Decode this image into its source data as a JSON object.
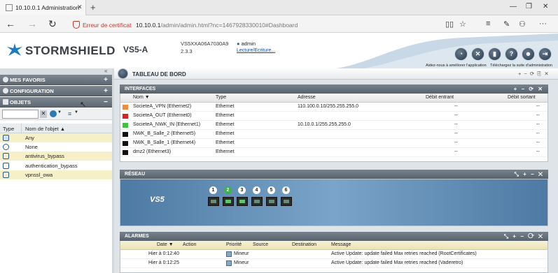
{
  "browser": {
    "tab_title": "10.10.0.1 Administration",
    "tab_close": "✕",
    "new_tab": "+",
    "cert_warning": "Erreur de certificat",
    "url_host": "10.10.0.1",
    "url_path": "/admin/admin.html?nc=1467928330010#Dashboard"
  },
  "header": {
    "brand": "STORMSHIELD",
    "model": "VS5-A",
    "serial": "VS5XXA06A7030A9",
    "version": "2.3.3",
    "user": "admin",
    "access_link": "Lecture/Ecriture...",
    "help_left": "Aidez-nous à améliorer l'application",
    "help_right": "Téléchargez la suite d'administration"
  },
  "sidebar": {
    "sections": [
      {
        "label": "MES FAVORIS",
        "toggle": "+"
      },
      {
        "label": "CONFIGURATION",
        "toggle": "+"
      },
      {
        "label": "OBJETS",
        "toggle": "−"
      }
    ],
    "col_type": "Type",
    "col_name": "Nom de l'objet ▲",
    "objects": [
      "Any",
      "None",
      "antivirus_bypass",
      "authentication_bypass",
      "vpnssl_owa"
    ]
  },
  "dashboard": {
    "title": "TABLEAU DE BORD",
    "controls": "+ − ⟳ ⎘ ✕"
  },
  "interfaces": {
    "title": "INTERFACES",
    "controls": "+ − ⟳ ✕",
    "columns": [
      "Nom ▼",
      "Type",
      "Adresse",
      "Débit entrant",
      "Débit sortant"
    ],
    "rows": [
      {
        "name": "SocieteA_VPN (Ethernet2)",
        "type": "Ethernet",
        "address": "110.100.0.10/255.255.255.0",
        "in": "--",
        "out": "--",
        "color": "#f08a3c"
      },
      {
        "name": "SocieteA_OUT (Ethernet0)",
        "type": "Ethernet",
        "address": "",
        "in": "--",
        "out": "--",
        "color": "#e02020"
      },
      {
        "name": "SocieteA_NWK_IN (Ethernet1)",
        "type": "Ethernet",
        "address": "10.10.0.1/255.255.255.0",
        "in": "--",
        "out": "--",
        "color": "#3cc23c"
      },
      {
        "name": "NWK_B_Salle_2 (Ethernet5)",
        "type": "Ethernet",
        "address": "",
        "in": "--",
        "out": "--",
        "color": "#111111"
      },
      {
        "name": "NWK_B_Salle_1 (Ethernet4)",
        "type": "Ethernet",
        "address": "",
        "in": "--",
        "out": "--",
        "color": "#111111"
      },
      {
        "name": "dmz2 (Ethernet3)",
        "type": "Ethernet",
        "address": "",
        "in": "--",
        "out": "--",
        "color": "#111111"
      }
    ]
  },
  "network": {
    "title": "RÉSEAU",
    "controls": "⤡ + − ✕",
    "model_label": "VS5",
    "ports": [
      "1",
      "2",
      "3",
      "4",
      "5",
      "6"
    ],
    "active_port": "2"
  },
  "alarms": {
    "title": "ALARMES",
    "controls": "⤡ + − ⟳ ✕",
    "columns": [
      "Date ▼",
      "Action",
      "Priorité",
      "Source",
      "Destination",
      "Message"
    ],
    "rows": [
      {
        "date": "Hier à 0:12:40",
        "action": "",
        "priority": "Mineur",
        "source": "",
        "destination": "",
        "message": "Active Update: update failed Max retries reached (RootCertificates)"
      },
      {
        "date": "Hier à 0:12:25",
        "action": "",
        "priority": "Mineur",
        "source": "",
        "destination": "",
        "message": "Active Update: update failed Max retries reached (Vaderetro)"
      }
    ]
  }
}
